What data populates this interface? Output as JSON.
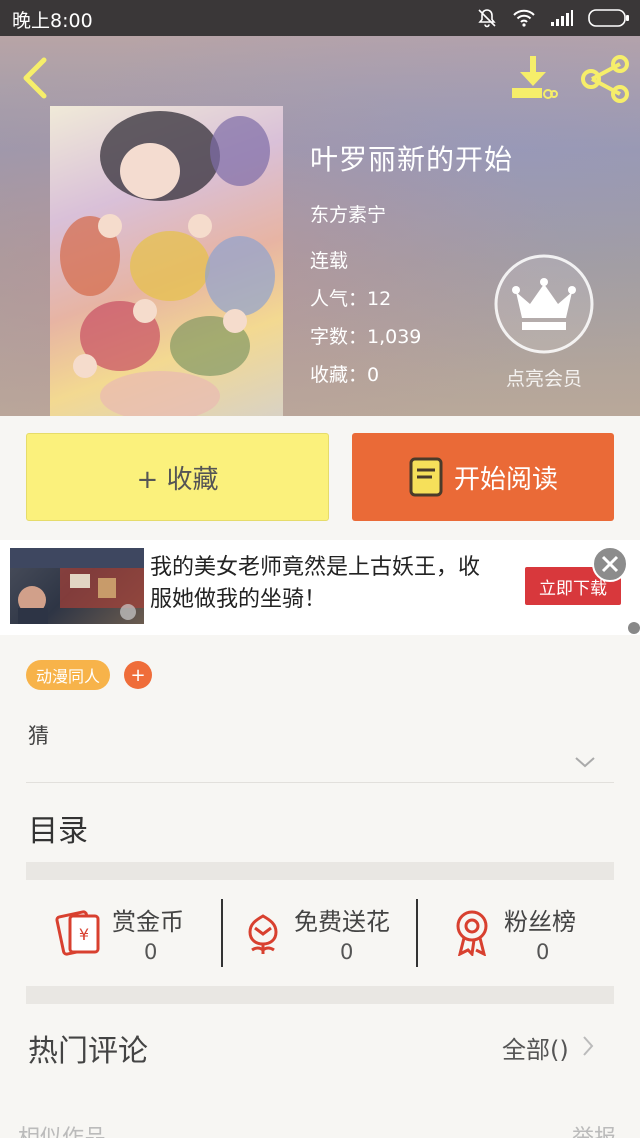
{
  "status_bar": {
    "time": "晚上8:00"
  },
  "book": {
    "title": "叶罗丽新的开始",
    "author": "东方素宁",
    "status": "连载",
    "popularity": "人气：12",
    "word_count": "字数：1,039",
    "favorites": "收藏：0"
  },
  "vip": {
    "label": "点亮会员"
  },
  "actions": {
    "collect_label": "+ 收藏",
    "read_label": "开始阅读"
  },
  "ad": {
    "text": "我的美女老师竟然是上古妖王，收服她做我的坐骑！",
    "button": "立即下载"
  },
  "tags": [
    {
      "label": "动漫同人"
    }
  ],
  "tag_add_label": "+",
  "intro_text": "猜",
  "toc_title": "目录",
  "stats": [
    {
      "label": "赏金币",
      "value": "0",
      "icon": "red-packet-icon"
    },
    {
      "label": "免费送花",
      "value": "0",
      "icon": "flower-icon"
    },
    {
      "label": "粉丝榜",
      "value": "0",
      "icon": "ribbon-medal-icon"
    }
  ],
  "hot_comments": {
    "title": "热门评论",
    "all_label": "全部()"
  },
  "bottom": {
    "left": "相似作品",
    "right": "举报"
  },
  "colors": {
    "accent_orange": "#ea6a37",
    "accent_yellow": "#fbf17c",
    "icon_yellow": "#f6ee6a",
    "icon_red": "#d8402f"
  }
}
